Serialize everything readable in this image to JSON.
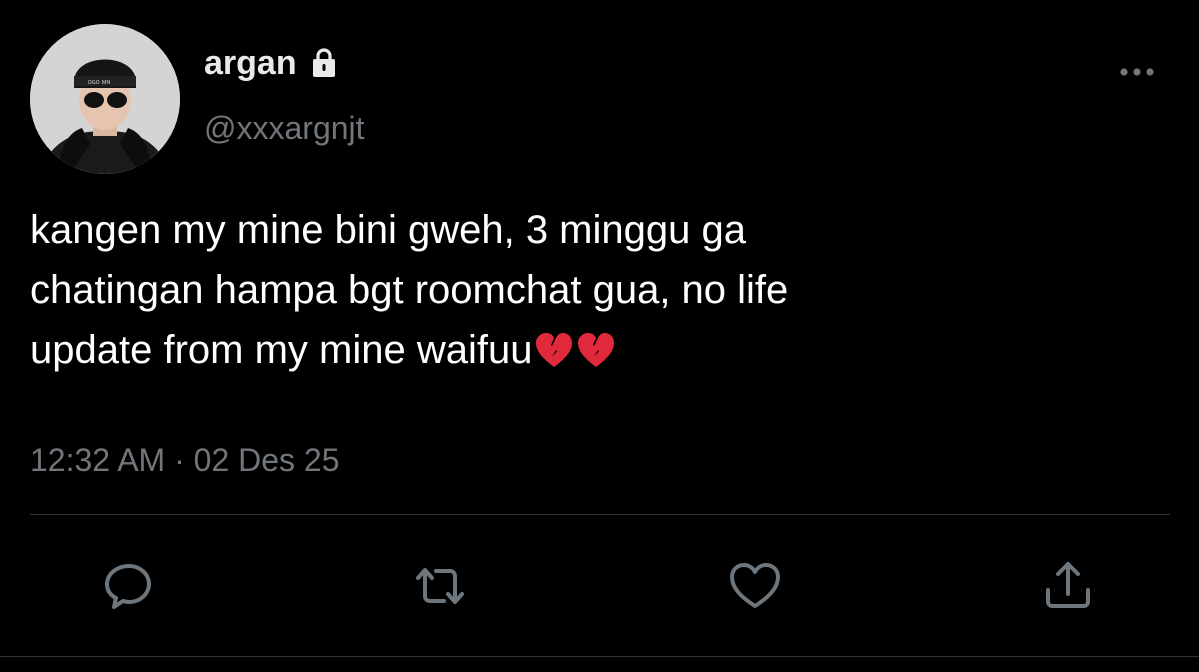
{
  "user": {
    "display_name": "argan",
    "handle": "@xxxargnjt",
    "protected_icon": "lock-icon",
    "avatar_icon": "avatar-photo"
  },
  "tweet": {
    "text": "kangen my mine bini gweh, 3 minggu ga\nchatingan hampa bgt roomchat gua, no life\nupdate from my mine waifuu",
    "emojis": [
      "broken-heart-icon",
      "broken-heart-icon"
    ],
    "timestamp": "12:32 AM · 02 Des 25"
  },
  "actions": [
    {
      "name": "reply",
      "icon": "comment-icon"
    },
    {
      "name": "retweet",
      "icon": "retweet-icon"
    },
    {
      "name": "like",
      "icon": "heart-icon"
    },
    {
      "name": "share",
      "icon": "share-icon"
    }
  ],
  "colors": {
    "background": "#000000",
    "text": "#ffffff",
    "secondary": "#71767b",
    "icon": "#6e767d",
    "emoji": "#e0293b"
  }
}
